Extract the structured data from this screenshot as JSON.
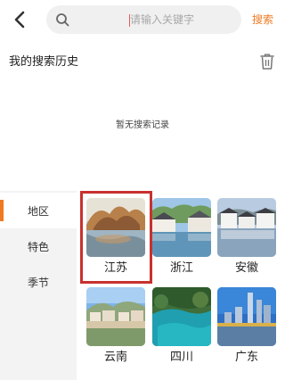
{
  "search": {
    "placeholder": "请输入关键字",
    "button_label": "搜索"
  },
  "history": {
    "title": "我的搜索历史",
    "empty_text": "暂无搜索记录"
  },
  "sidebar": {
    "items": [
      {
        "label": "地区",
        "active": true
      },
      {
        "label": "特色",
        "active": false
      },
      {
        "label": "季节",
        "active": false
      }
    ]
  },
  "regions": [
    {
      "name": "江苏",
      "selected": true
    },
    {
      "name": "浙江",
      "selected": false
    },
    {
      "name": "安徽",
      "selected": false
    },
    {
      "name": "云南",
      "selected": false
    },
    {
      "name": "四川",
      "selected": false
    },
    {
      "name": "广东",
      "selected": false
    }
  ],
  "colors": {
    "accent": "#f07a22",
    "selection_border": "#c8312e",
    "sidebar_bg": "#f3f3f3"
  }
}
